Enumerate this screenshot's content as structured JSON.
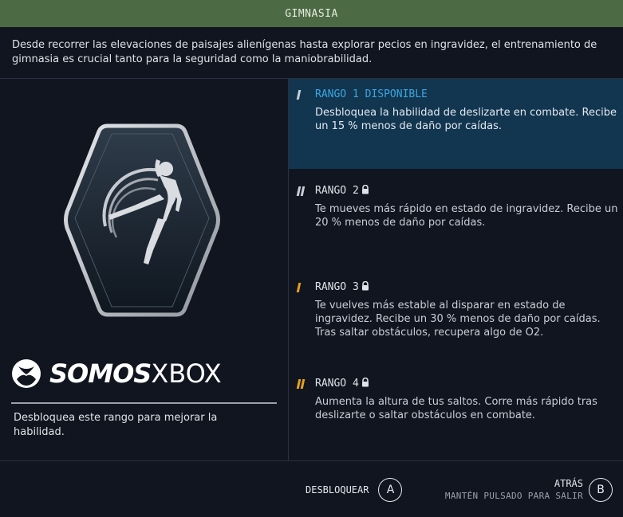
{
  "header": {
    "title": "GIMNASIA"
  },
  "intro": "Desde recorrer las elevaciones de paisajes alienígenas hasta explorar pecios en ingravidez, el entrenamiento de gimnasia es crucial tanto para la seguridad como la maniobrabilidad.",
  "skill": {
    "icon": "gymnast-badge-icon",
    "logo_text_bold": "SOMOS",
    "logo_text_thin": "XBOX",
    "description": "Desbloquea este rango para mejorar la habilidad."
  },
  "ranks": [
    {
      "title": "RANGO 1 DISPONIBLE",
      "locked": false,
      "selected": true,
      "tier_bars": 1,
      "bar_color": "#c9ced6",
      "description": "Desbloquea la habilidad de deslizarte en combate. Recibe un 15 % menos de daño por caídas."
    },
    {
      "title": "RANGO 2",
      "locked": true,
      "selected": false,
      "tier_bars": 2,
      "bar_color": "#c9ced6",
      "description": "Te mueves más rápido en estado de ingravidez. Recibe un 20 % menos de daño por caídas."
    },
    {
      "title": "RANGO 3",
      "locked": true,
      "selected": false,
      "tier_bars": 1,
      "bar_color": "#e6a21e",
      "description": "Te vuelves más estable al disparar en estado de ingravidez. Recibe un 30 % menos de daño por caídas. Tras saltar obstáculos, recupera algo de O2."
    },
    {
      "title": "RANGO 4",
      "locked": true,
      "selected": false,
      "tier_bars": 2,
      "bar_color": "#e6a21e",
      "description": "Aumenta la altura de tus saltos. Corre más rápido tras deslizarte o saltar obstáculos en combate."
    }
  ],
  "footer": {
    "unlock_label": "DESBLOQUEAR",
    "unlock_button": "A",
    "back_label": "ATRÁS",
    "back_hint": "MANTÉN PULSADO PARA SALIR",
    "back_button": "B"
  },
  "colors": {
    "header_bg": "#4c6a43",
    "selected_bg": "#123650",
    "selected_text": "#3aa6e0",
    "tier_gold": "#e6a21e"
  }
}
